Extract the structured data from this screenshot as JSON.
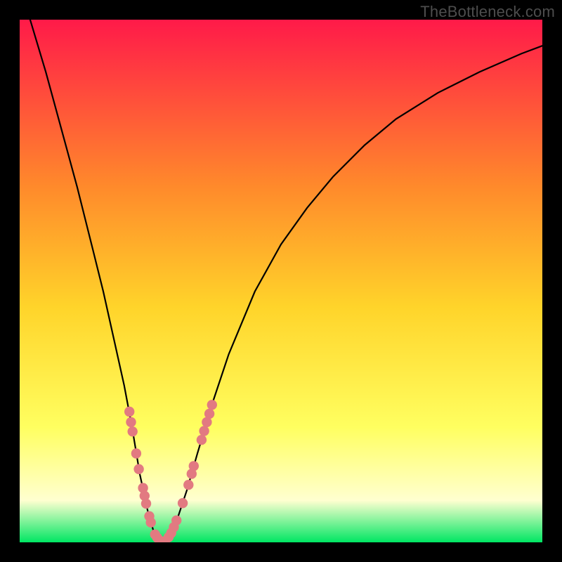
{
  "watermark": "TheBottleneck.com",
  "colors": {
    "frame": "#000000",
    "grad_top": "#ff1a49",
    "grad_mid_upper": "#ff8a2b",
    "grad_mid": "#ffd42a",
    "grad_mid_lower": "#ffff60",
    "grad_pale": "#ffffd0",
    "grad_bottom": "#00e663",
    "curve": "#000000",
    "marker_fill": "#e27a81",
    "marker_stroke": "#cc5f67"
  },
  "chart_data": {
    "type": "line",
    "title": "",
    "xlabel": "",
    "ylabel": "",
    "xlim": [
      0,
      100
    ],
    "ylim": [
      0,
      100
    ],
    "series": [
      {
        "name": "bottleneck-curve",
        "x": [
          0,
          2,
          5,
          8,
          11,
          14,
          16,
          18,
          20,
          21.5,
          23,
          24.5,
          26,
          27.3,
          28,
          30,
          32,
          34,
          37,
          40,
          45,
          50,
          55,
          60,
          66,
          72,
          80,
          88,
          96,
          100
        ],
        "y": [
          107,
          100,
          90,
          79,
          68,
          56,
          48,
          39,
          30,
          22,
          13,
          6,
          0.8,
          0,
          0.7,
          4,
          10,
          17,
          27,
          36,
          48,
          57,
          64,
          70,
          76,
          81,
          86,
          90,
          93.5,
          95
        ]
      }
    ],
    "markers": [
      {
        "x": 21.0,
        "y": 25.0
      },
      {
        "x": 21.3,
        "y": 23.0
      },
      {
        "x": 21.6,
        "y": 21.2
      },
      {
        "x": 22.3,
        "y": 17.0
      },
      {
        "x": 22.8,
        "y": 14.0
      },
      {
        "x": 23.6,
        "y": 10.4
      },
      {
        "x": 23.9,
        "y": 8.9
      },
      {
        "x": 24.2,
        "y": 7.4
      },
      {
        "x": 24.8,
        "y": 5.0
      },
      {
        "x": 25.1,
        "y": 3.8
      },
      {
        "x": 25.9,
        "y": 1.5
      },
      {
        "x": 26.3,
        "y": 0.9
      },
      {
        "x": 26.7,
        "y": 0.4
      },
      {
        "x": 27.3,
        "y": 0.0
      },
      {
        "x": 27.8,
        "y": 0.2
      },
      {
        "x": 28.5,
        "y": 1.0
      },
      {
        "x": 29.0,
        "y": 1.8
      },
      {
        "x": 29.5,
        "y": 2.9
      },
      {
        "x": 30.0,
        "y": 4.2
      },
      {
        "x": 31.2,
        "y": 7.5
      },
      {
        "x": 32.3,
        "y": 11.0
      },
      {
        "x": 32.9,
        "y": 13.1
      },
      {
        "x": 33.3,
        "y": 14.6
      },
      {
        "x": 34.8,
        "y": 19.6
      },
      {
        "x": 35.3,
        "y": 21.3
      },
      {
        "x": 35.8,
        "y": 23.0
      },
      {
        "x": 36.3,
        "y": 24.6
      },
      {
        "x": 36.8,
        "y": 26.3
      }
    ],
    "optimum_x": 27.3
  }
}
